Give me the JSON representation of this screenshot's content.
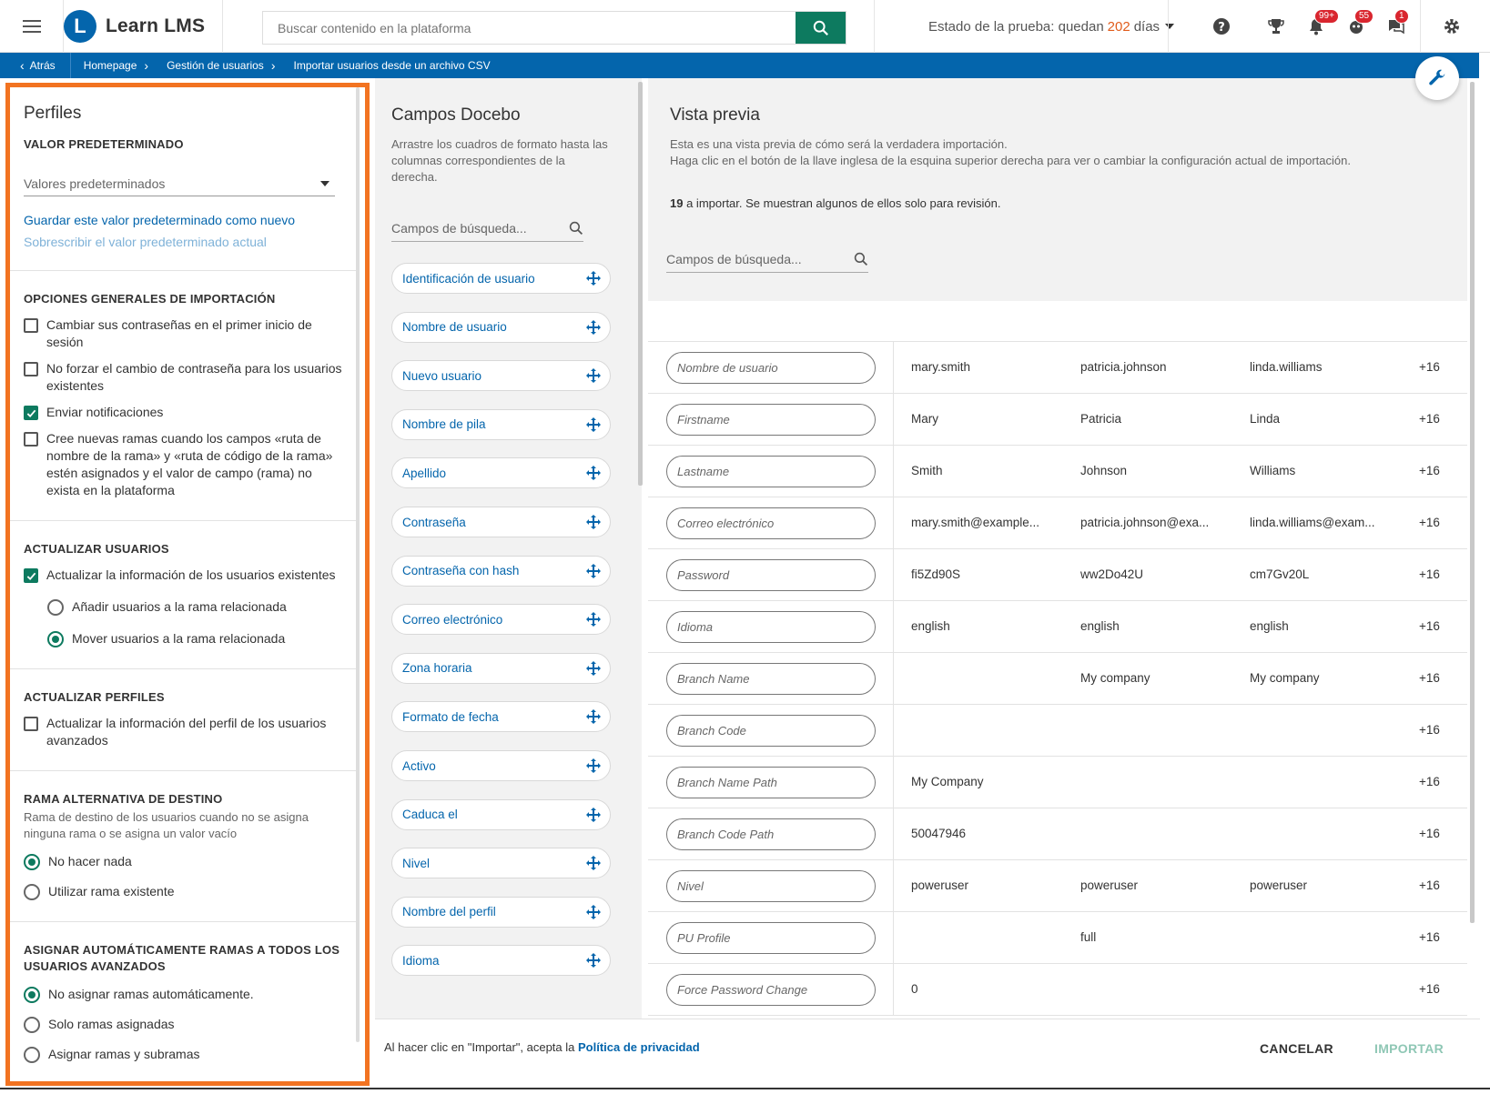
{
  "header": {
    "app_name": "Learn LMS",
    "logo_letter": "L",
    "search_placeholder": "Buscar contenido en la plataforma",
    "trial_prefix": "Estado de la prueba: quedan",
    "trial_days": "202",
    "trial_suffix": "días",
    "badges": {
      "notifications": "99+",
      "messages": "55",
      "chat": "1"
    }
  },
  "breadcrumb": {
    "back": "Atrás",
    "items": [
      "Homepage",
      "Gestión de usuarios",
      "Importar usuarios desde un archivo CSV"
    ]
  },
  "left": {
    "title": "Perfiles",
    "default_section": "VALOR PREDETERMINADO",
    "default_select": "Valores predeterminados",
    "save_link": "Guardar este valor predeterminado como nuevo",
    "overwrite_link": "Sobrescribir el valor predeterminado actual",
    "general": {
      "heading": "OPCIONES GENERALES DE IMPORTACIÓN",
      "options": [
        {
          "label": "Cambiar sus contraseñas en el primer inicio de sesión",
          "checked": false
        },
        {
          "label": "No forzar el cambio de contraseña para los usuarios existentes",
          "checked": false
        },
        {
          "label": "Enviar notificaciones",
          "checked": true
        },
        {
          "label": "Cree nuevas ramas cuando los campos «ruta de nombre de la rama» y «ruta de código de la rama» estén asignados y el valor de campo (rama) no exista en la plataforma",
          "checked": false
        }
      ]
    },
    "update_users": {
      "heading": "ACTUALIZAR USUARIOS",
      "checkbox": "Actualizar la información de los usuarios existentes",
      "radio_add": "Añadir usuarios a la rama relacionada",
      "radio_move": "Mover usuarios a la rama relacionada"
    },
    "update_profiles": {
      "heading": "ACTUALIZAR PERFILES",
      "checkbox": "Actualizar la información del perfil de los usuarios avanzados"
    },
    "alt_branch": {
      "heading": "RAMA ALTERNATIVA DE DESTINO",
      "desc": "Rama de destino de los usuarios cuando no se asigna ninguna rama o se asigna un valor vacío",
      "radio_nothing": "No hacer nada",
      "radio_existing": "Utilizar rama existente"
    },
    "auto_assign": {
      "heading": "ASIGNAR AUTOMÁTICAMENTE RAMAS A TODOS LOS USUARIOS AVANZADOS",
      "radio_none": "No asignar ramas automáticamente.",
      "radio_assigned": "Solo ramas asignadas",
      "radio_sub": "Asignar ramas y subramas"
    }
  },
  "middle": {
    "title": "Campos Docebo",
    "desc": "Arrastre los cuadros de formato hasta las columnas correspondientes de la derecha.",
    "search_placeholder": "Campos de búsqueda...",
    "fields": [
      "Identificación de usuario",
      "Nombre de usuario",
      "Nuevo usuario",
      "Nombre de pila",
      "Apellido",
      "Contraseña",
      "Contraseña con hash",
      "Correo electrónico",
      "Zona horaria",
      "Formato de fecha",
      "Activo",
      "Caduca el",
      "Nivel",
      "Nombre del perfil",
      "Idioma"
    ]
  },
  "right": {
    "title": "Vista previa",
    "desc1": "Esta es una vista previa de cómo será la verdadera importación.",
    "desc2": "Haga clic en el botón de la llave inglesa de la esquina superior derecha para ver o cambiar la configuración actual de importación.",
    "count_num": "19",
    "count_text": "a importar. Se muestran algunos de ellos solo para revisión.",
    "search_placeholder": "Campos de búsqueda...",
    "rows": [
      {
        "field": "Nombre de usuario",
        "v1": "mary.smith",
        "v2": "patricia.johnson",
        "v3": "linda.williams",
        "more": "+16"
      },
      {
        "field": "Firstname",
        "v1": "Mary",
        "v2": "Patricia",
        "v3": "Linda",
        "more": "+16"
      },
      {
        "field": "Lastname",
        "v1": "Smith",
        "v2": "Johnson",
        "v3": "Williams",
        "more": "+16"
      },
      {
        "field": "Correo electrónico",
        "v1": "mary.smith@example...",
        "v2": "patricia.johnson@exa...",
        "v3": "linda.williams@exam...",
        "more": "+16"
      },
      {
        "field": "Password",
        "v1": "fi5Zd90S",
        "v2": "ww2Do42U",
        "v3": "cm7Gv20L",
        "more": "+16"
      },
      {
        "field": "Idioma",
        "v1": "english",
        "v2": "english",
        "v3": "english",
        "more": "+16"
      },
      {
        "field": "Branch Name",
        "v1": "",
        "v2": "My company",
        "v3": "My company",
        "more": "+16"
      },
      {
        "field": "Branch Code",
        "v1": "",
        "v2": "",
        "v3": "",
        "more": "+16"
      },
      {
        "field": "Branch Name Path",
        "v1": "My Company",
        "v2": "",
        "v3": "",
        "more": "+16"
      },
      {
        "field": "Branch Code Path",
        "v1": "50047946",
        "v2": "",
        "v3": "",
        "more": "+16"
      },
      {
        "field": "Nivel",
        "v1": "poweruser",
        "v2": "poweruser",
        "v3": "poweruser",
        "more": "+16"
      },
      {
        "field": "PU Profile",
        "v1": "",
        "v2": "full",
        "v3": "",
        "more": "+16"
      },
      {
        "field": "Force Password Change",
        "v1": "0",
        "v2": "",
        "v3": "",
        "more": "+16"
      }
    ]
  },
  "footer": {
    "legal_text": "Al hacer clic en \"Importar\", acepta la",
    "legal_link": "Política de privacidad",
    "cancel": "CANCELAR",
    "import": "IMPORTAR"
  },
  "colors": {
    "brand_blue": "#0465ac",
    "accent_green": "#0d7a5f",
    "highlight_orange": "#f27321"
  }
}
